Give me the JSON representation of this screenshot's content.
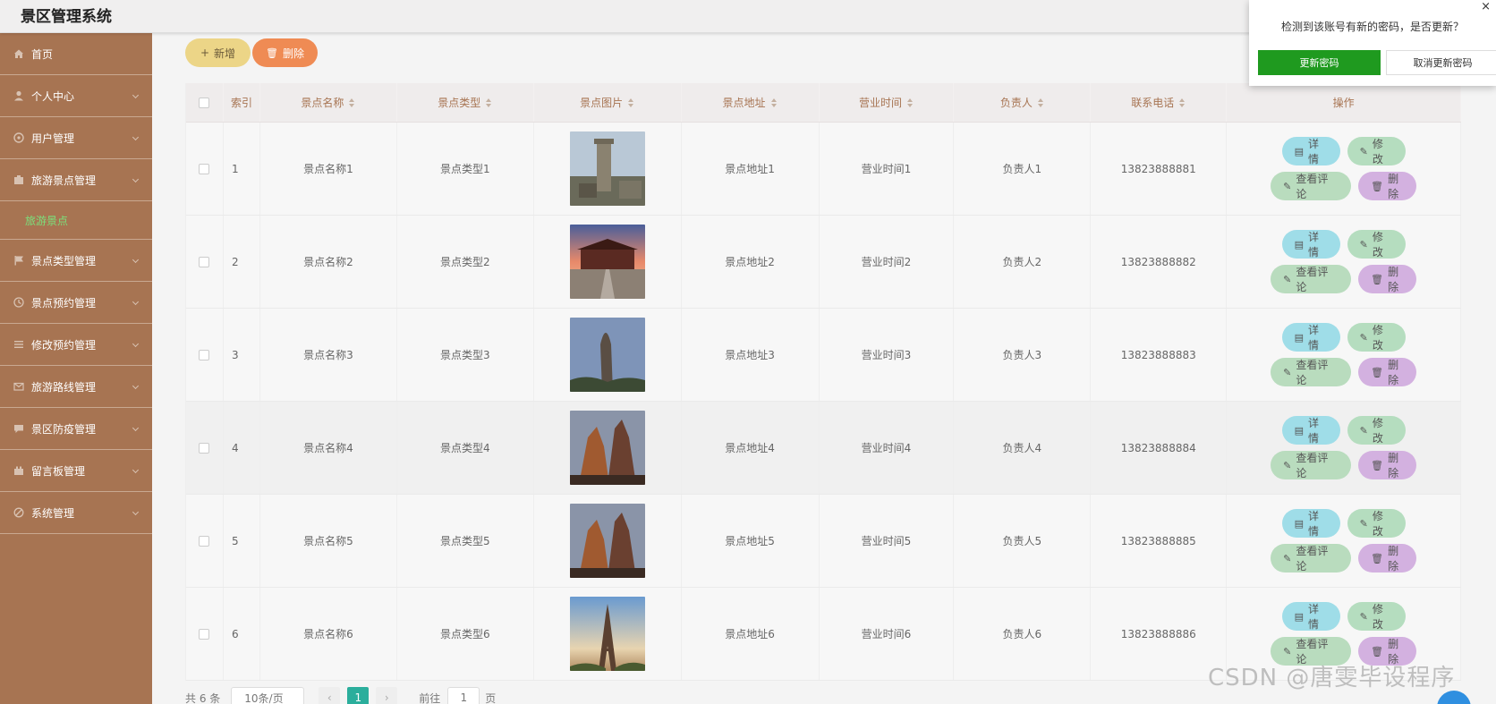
{
  "app": {
    "title": "景区管理系统"
  },
  "sidebar": {
    "items": [
      {
        "label": "首页",
        "icon": "home-icon",
        "chevron": false
      },
      {
        "label": "个人中心",
        "icon": "user-icon",
        "chevron": true
      },
      {
        "label": "用户管理",
        "icon": "users-icon",
        "chevron": true
      },
      {
        "label": "旅游景点管理",
        "icon": "scenic-icon",
        "chevron": true
      },
      {
        "label": "景点类型管理",
        "icon": "flag-icon",
        "chevron": true
      },
      {
        "label": "景点预约管理",
        "icon": "clock-icon",
        "chevron": true
      },
      {
        "label": "修改预约管理",
        "icon": "list-icon",
        "chevron": true
      },
      {
        "label": "旅游路线管理",
        "icon": "mail-icon",
        "chevron": true
      },
      {
        "label": "景区防疫管理",
        "icon": "chat-icon",
        "chevron": true
      },
      {
        "label": "留言板管理",
        "icon": "board-icon",
        "chevron": true
      },
      {
        "label": "系统管理",
        "icon": "settings-icon",
        "chevron": true
      }
    ],
    "active_sub": "旅游景点"
  },
  "toolbar": {
    "add_label": "新增",
    "delete_label": "删除",
    "add_icon": "+",
    "delete_icon": "🗑"
  },
  "table": {
    "headers": [
      "索引",
      "景点名称",
      "景点类型",
      "景点图片",
      "景点地址",
      "营业时间",
      "负责人",
      "联系电话",
      "操作"
    ],
    "rows": [
      {
        "index": "1",
        "name": "景点名称1",
        "type": "景点类型1",
        "address": "景点地址1",
        "hours": "营业时间1",
        "manager": "负责人1",
        "phone": "13823888881"
      },
      {
        "index": "2",
        "name": "景点名称2",
        "type": "景点类型2",
        "address": "景点地址2",
        "hours": "营业时间2",
        "manager": "负责人2",
        "phone": "13823888882"
      },
      {
        "index": "3",
        "name": "景点名称3",
        "type": "景点类型3",
        "address": "景点地址3",
        "hours": "营业时间3",
        "manager": "负责人3",
        "phone": "13823888883"
      },
      {
        "index": "4",
        "name": "景点名称4",
        "type": "景点类型4",
        "address": "景点地址4",
        "hours": "营业时间4",
        "manager": "负责人4",
        "phone": "13823888884"
      },
      {
        "index": "5",
        "name": "景点名称5",
        "type": "景点类型5",
        "address": "景点地址5",
        "hours": "营业时间5",
        "manager": "负责人5",
        "phone": "13823888885"
      },
      {
        "index": "6",
        "name": "景点名称6",
        "type": "景点类型6",
        "address": "景点地址6",
        "hours": "营业时间6",
        "manager": "负责人6",
        "phone": "13823888886"
      }
    ],
    "actions": {
      "detail": "详情",
      "edit": "修改",
      "review": "查看评论",
      "remove": "删除"
    }
  },
  "pager": {
    "total": "共 6 条",
    "page_size": "10条/页",
    "current": "1",
    "goto": "前往",
    "goto_value": "1",
    "page_unit": "页"
  },
  "popup": {
    "message": "检测到该账号有新的密码，是否更新？",
    "ok": "更新密码",
    "cancel": "取消更新密码",
    "close": "×"
  },
  "watermark": "CSDN @唐雯毕设程序",
  "colors": {
    "sidebar": "#a77452",
    "accent": "#2bae9c",
    "ok_green": "#1f9a1f",
    "active_sub": "#7be07b"
  }
}
